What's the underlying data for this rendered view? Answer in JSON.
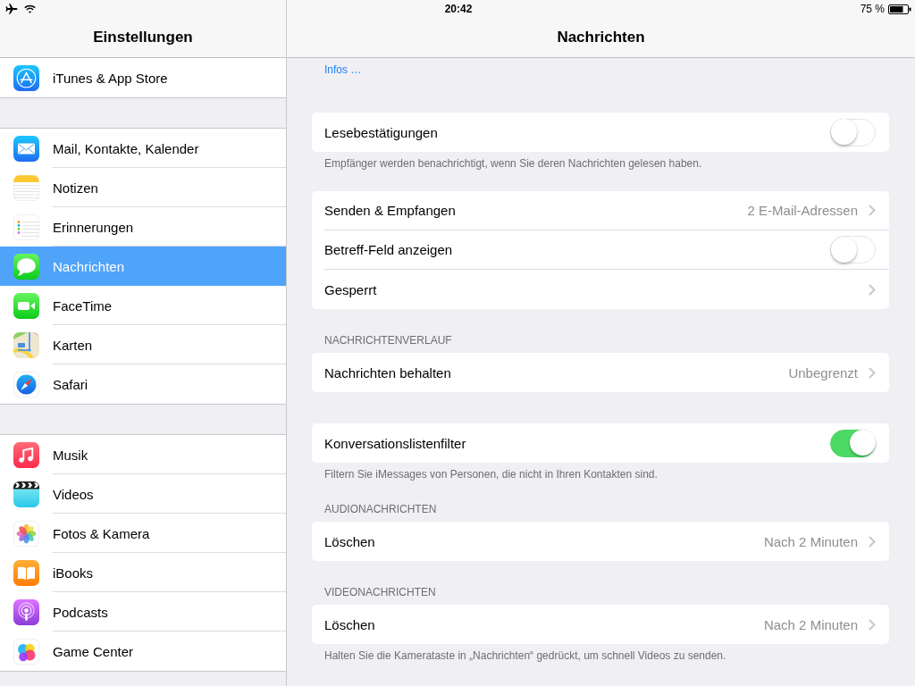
{
  "status_bar": {
    "time": "20:42",
    "battery": "75 %"
  },
  "sidebar": {
    "title": "Einstellungen",
    "groups": [
      {
        "items": [
          {
            "label": "iTunes & App Store",
            "selected": false
          }
        ]
      },
      {
        "items": [
          {
            "label": "Mail, Kontakte, Kalender",
            "selected": false
          },
          {
            "label": "Notizen",
            "selected": false
          },
          {
            "label": "Erinnerungen",
            "selected": false
          },
          {
            "label": "Nachrichten",
            "selected": true
          },
          {
            "label": "FaceTime",
            "selected": false
          },
          {
            "label": "Karten",
            "selected": false
          },
          {
            "label": "Safari",
            "selected": false
          }
        ]
      },
      {
        "items": [
          {
            "label": "Musik",
            "selected": false
          },
          {
            "label": "Videos",
            "selected": false
          },
          {
            "label": "Fotos & Kamera",
            "selected": false
          },
          {
            "label": "iBooks",
            "selected": false
          },
          {
            "label": "Podcasts",
            "selected": false
          },
          {
            "label": "Game Center",
            "selected": false
          }
        ]
      }
    ]
  },
  "detail": {
    "title": "Nachrichten",
    "intro_link": "Infos …",
    "sections": [
      {
        "rows": [
          {
            "kind": "toggle",
            "label": "Lesebestätigungen",
            "on": false
          }
        ],
        "footer": "Empfänger werden benachrichtigt, wenn Sie deren Nachrichten gelesen haben."
      },
      {
        "rows": [
          {
            "kind": "link",
            "label": "Senden & Empfangen",
            "value": "2 E-Mail-Adressen"
          },
          {
            "kind": "toggle",
            "label": "Betreff-Feld anzeigen",
            "on": false
          },
          {
            "kind": "link",
            "label": "Gesperrt"
          }
        ]
      },
      {
        "header": "NACHRICHTENVERLAUF",
        "rows": [
          {
            "kind": "link",
            "label": "Nachrichten behalten",
            "value": "Unbegrenzt"
          }
        ]
      },
      {
        "rows": [
          {
            "kind": "toggle",
            "label": "Konversationslistenfilter",
            "on": true
          }
        ],
        "footer": "Filtern Sie iMessages von Personen, die nicht in Ihren Kontakten sind."
      },
      {
        "header": "AUDIONACHRICHTEN",
        "rows": [
          {
            "kind": "link",
            "label": "Löschen",
            "value": "Nach 2 Minuten"
          }
        ]
      },
      {
        "header": "VIDEONACHRICHTEN",
        "rows": [
          {
            "kind": "link",
            "label": "Löschen",
            "value": "Nach 2 Minuten"
          }
        ],
        "footer": "Halten Sie die Kamerataste in „Nachrichten“ gedrückt, um schnell Videos zu senden."
      }
    ]
  }
}
